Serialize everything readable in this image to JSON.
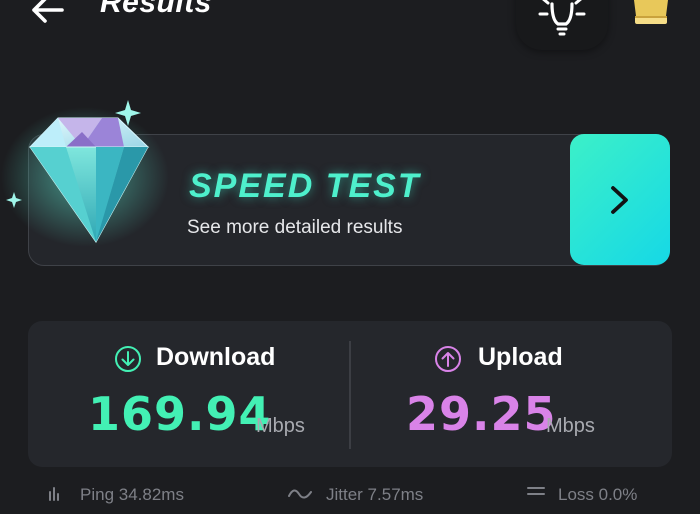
{
  "header": {
    "title": "Results",
    "back_icon": "arrow-left-icon",
    "bulb_icon": "lightbulb-icon",
    "crown_icon": "crown-icon"
  },
  "promo": {
    "title": "SPEED TEST",
    "subtitle": "See more detailed results",
    "arrow_icon": "chevron-right-icon",
    "accent_color": "#4ef0cc"
  },
  "results": {
    "download": {
      "label": "Download",
      "value": "169.94",
      "unit": "Mbps",
      "icon": "arrow-down-circle-icon",
      "color": "#43f0b4"
    },
    "upload": {
      "label": "Upload",
      "value": "29.25",
      "unit": "Mbps",
      "icon": "arrow-up-circle-icon",
      "color": "#d983e8"
    }
  },
  "stats": {
    "ping": "Ping 34.82ms",
    "jitter": "Jitter 7.57ms",
    "loss": "Loss 0.0%"
  }
}
